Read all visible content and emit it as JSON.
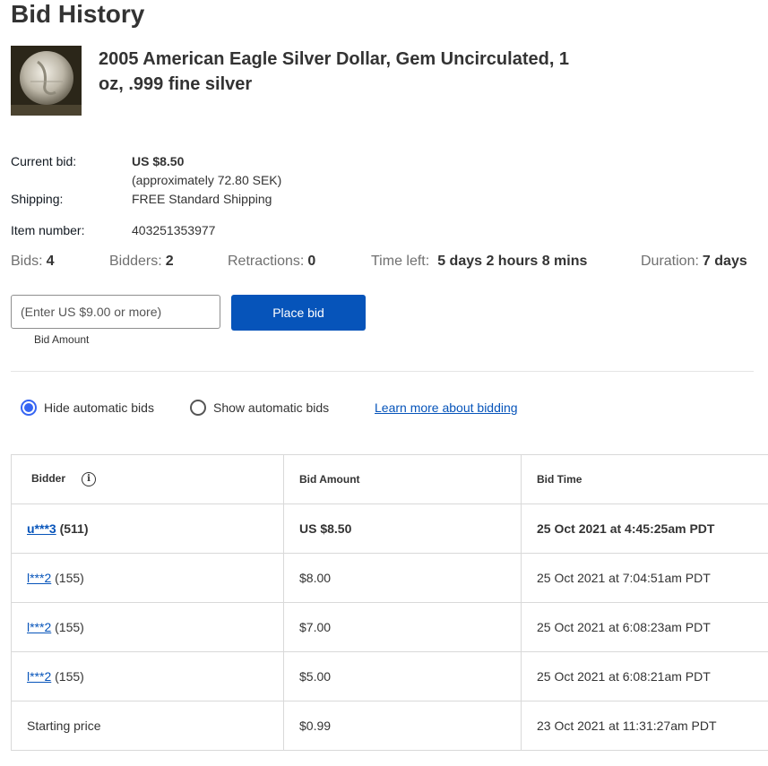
{
  "page": {
    "title": "Bid History"
  },
  "item": {
    "title": "2005 American Eagle Silver Dollar, Gem Uncirculated, 1 oz, .999 fine silver",
    "current_bid_label": "Current bid:",
    "current_bid_value": "US $8.50",
    "current_bid_approx": "(approximately 72.80 SEK)",
    "shipping_label": "Shipping:",
    "shipping_value": "FREE Standard Shipping",
    "item_number_label": "Item number:",
    "item_number_value": "403251353977"
  },
  "stats": {
    "bids_label": "Bids:",
    "bids_value": "4",
    "bidders_label": "Bidders:",
    "bidders_value": "2",
    "retractions_label": "Retractions:",
    "retractions_value": "0",
    "time_left_label": "Time left:",
    "time_left_value": "5 days 2 hours 8 mins",
    "duration_label": "Duration:",
    "duration_value": "7 days"
  },
  "bid_form": {
    "placeholder": "(Enter US $9.00 or more)",
    "caption": "Bid Amount",
    "button_label": "Place bid"
  },
  "options": {
    "hide_auto_label": "Hide automatic bids",
    "show_auto_label": "Show automatic bids",
    "learn_more_label": "Learn more about bidding"
  },
  "table": {
    "headers": {
      "bidder": "Bidder",
      "amount": "Bid Amount",
      "time": "Bid Time"
    },
    "rows": [
      {
        "bidder": "u***3",
        "score": "(511)",
        "amount": "US $8.50",
        "time": "25 Oct 2021 at 4:45:25am PDT"
      },
      {
        "bidder": "l***2",
        "score": "(155)",
        "amount": "$8.00",
        "time": "25 Oct 2021 at 7:04:51am PDT"
      },
      {
        "bidder": "l***2",
        "score": "(155)",
        "amount": "$7.00",
        "time": "25 Oct 2021 at 6:08:23am PDT"
      },
      {
        "bidder": "l***2",
        "score": "(155)",
        "amount": "$5.00",
        "time": "25 Oct 2021 at 6:08:21am PDT"
      }
    ],
    "starting": {
      "label": "Starting price",
      "amount": "$0.99",
      "time": "23 Oct 2021 at 11:31:27am PDT"
    }
  },
  "colors": {
    "primary": "#0654ba",
    "radio": "#3665f3"
  }
}
